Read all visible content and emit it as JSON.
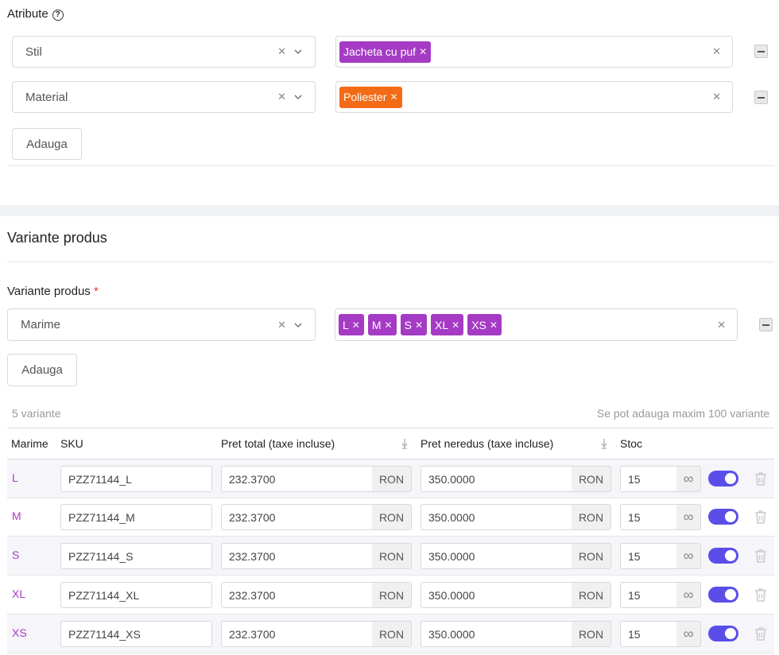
{
  "attributes": {
    "title": "Atribute",
    "help_icon": "?",
    "rows": [
      {
        "name": "Stil",
        "tags": [
          {
            "label": "Jacheta cu puf",
            "color": "#a53bc4"
          }
        ]
      },
      {
        "name": "Material",
        "tags": [
          {
            "label": "Poliester",
            "color": "#f36b16"
          }
        ]
      }
    ],
    "add_label": "Adauga"
  },
  "variants_section": {
    "title": "Variante produs",
    "field_label": "Variante produs",
    "required_mark": "*",
    "select_value": "Marime",
    "tags": [
      "L",
      "M",
      "S",
      "XL",
      "XS"
    ],
    "add_label": "Adauga",
    "count_text": "5 variante",
    "max_text": "Se pot adauga maxim 100 variante"
  },
  "table": {
    "headers": {
      "size": "Marime",
      "sku": "SKU",
      "price_total": "Pret total (taxe incluse)",
      "price_undiscounted": "Pret neredus (taxe incluse)",
      "stock": "Stoc"
    },
    "currency": "RON",
    "infinity": "∞",
    "rows": [
      {
        "size": "L",
        "sku": "PZZ71144_L",
        "price": "232.3700",
        "old_price": "350.0000",
        "stock": "15"
      },
      {
        "size": "M",
        "sku": "PZZ71144_M",
        "price": "232.3700",
        "old_price": "350.0000",
        "stock": "15"
      },
      {
        "size": "S",
        "sku": "PZZ71144_S",
        "price": "232.3700",
        "old_price": "350.0000",
        "stock": "15"
      },
      {
        "size": "XL",
        "sku": "PZZ71144_XL",
        "price": "232.3700",
        "old_price": "350.0000",
        "stock": "15"
      },
      {
        "size": "XS",
        "sku": "PZZ71144_XS",
        "price": "232.3700",
        "old_price": "350.0000",
        "stock": "15"
      }
    ]
  },
  "colors": {
    "accent": "#5b4ee8",
    "size_text": "#a53bc4",
    "tag_purple": "#a53bc4",
    "tag_orange": "#f36b16"
  }
}
